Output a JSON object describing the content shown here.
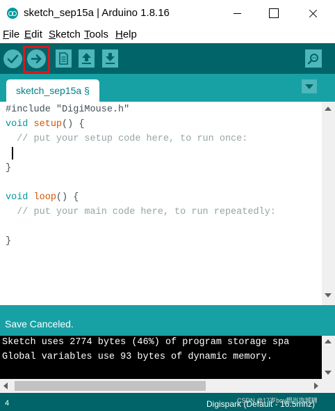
{
  "window": {
    "title": "sketch_sep15a | Arduino 1.8.16",
    "logo_icon": "arduino-logo-icon",
    "controls": [
      "minimize-icon",
      "maximize-icon",
      "close-icon"
    ]
  },
  "menu": {
    "items": [
      {
        "underline": "F",
        "rest": "ile"
      },
      {
        "underline": "E",
        "rest": "dit"
      },
      {
        "underline": "S",
        "rest": "ketch"
      },
      {
        "underline": "T",
        "rest": "ools"
      },
      {
        "underline": "H",
        "rest": "elp"
      }
    ]
  },
  "toolbar": {
    "buttons": [
      "verify-icon",
      "upload-icon",
      "new-icon",
      "open-icon",
      "save-icon"
    ],
    "right_button": "serial-monitor-icon",
    "highlighted": "upload-icon",
    "highlight_color": "#e0151b"
  },
  "tab": {
    "label": "sketch_sep15a §"
  },
  "editor": {
    "lines": [
      {
        "a": "#include \"DigiMouse.h\""
      },
      {
        "kw": "void",
        "fn": "setup",
        "rest": "() {"
      },
      {
        "comment": "  // put your setup code here, to run once:"
      },
      {
        "a": ""
      },
      {
        "a": "}"
      },
      {
        "a": ""
      },
      {
        "kw": "void",
        "fn": "loop",
        "rest": "() {"
      },
      {
        "comment": "  // put your main code here, to run repeatedly:"
      },
      {
        "a": ""
      },
      {
        "a": "}"
      }
    ]
  },
  "status": {
    "message": "Save Canceled."
  },
  "console": {
    "lines": [
      "Sketch uses 2774 bytes (46%) of program storage spa",
      "Global variables use 93 bytes of dynamic memory."
    ]
  },
  "bottom": {
    "line_number": "4",
    "board": "Digispark (Default - 16.5mhz)",
    "watermark": "CSDN @17岁boy想当攻城狮"
  },
  "colors": {
    "toolbar_bg": "#006468",
    "tab_bar_bg": "#17a1a5",
    "button_bg": "#4db7bb",
    "keyword": "#00979c",
    "function": "#d35400",
    "comment": "#95a5a6"
  }
}
